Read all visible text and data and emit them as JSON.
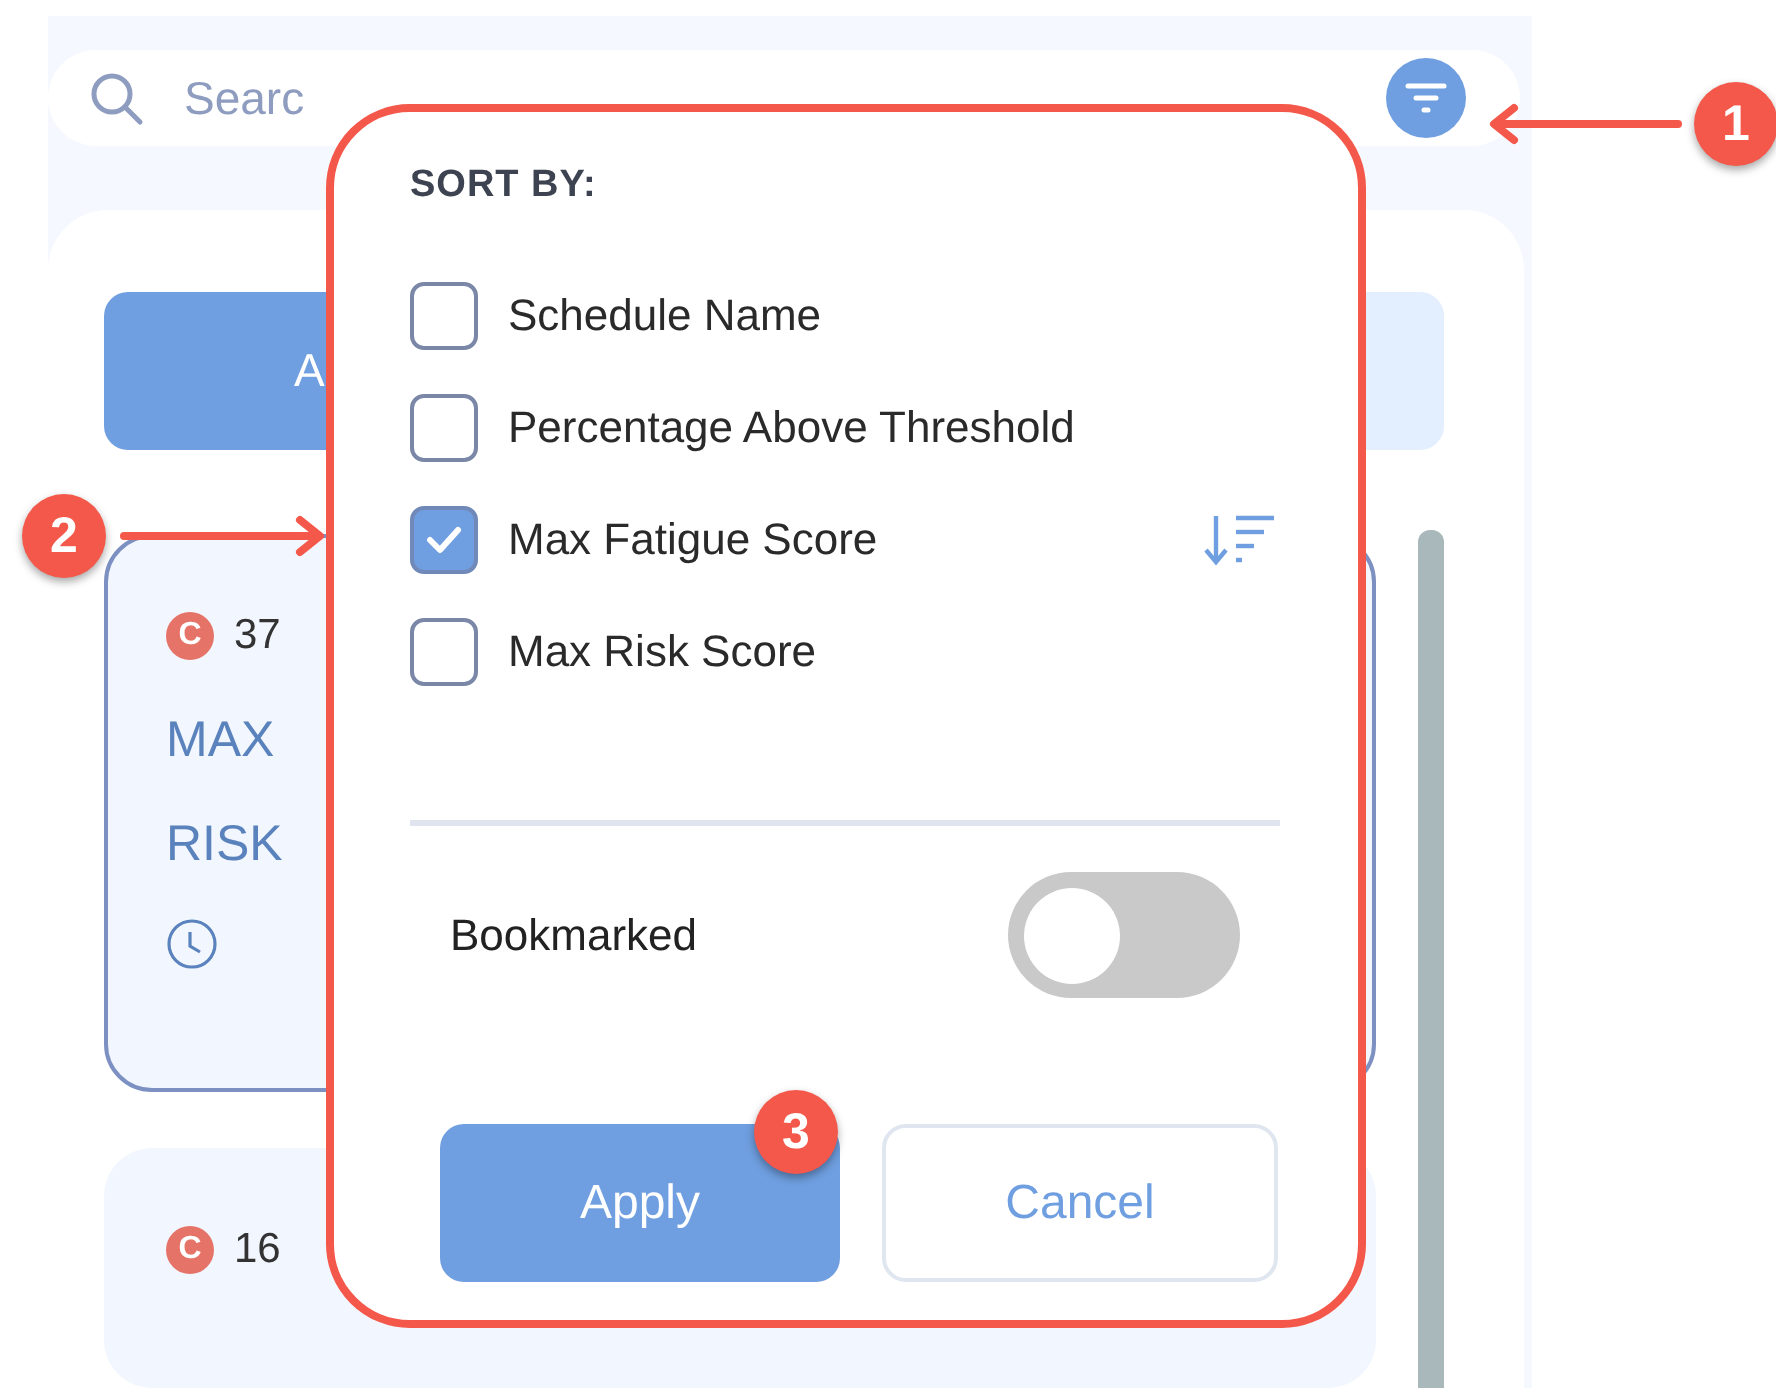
{
  "search": {
    "placeholder": "Searc"
  },
  "tabs": [
    {
      "label": "A",
      "selected": true
    },
    {
      "selected": false
    }
  ],
  "cards": [
    {
      "badge": "C",
      "id": "37",
      "lines": [
        "MAX",
        "RISK"
      ],
      "selected": true
    },
    {
      "badge": "C",
      "id": "16",
      "selected": false
    }
  ],
  "sort_popup": {
    "title": "SORT BY:",
    "options": [
      {
        "label": "Schedule Name",
        "checked": false
      },
      {
        "label": "Percentage Above Threshold",
        "checked": false
      },
      {
        "label": "Max Fatigue Score",
        "checked": true
      },
      {
        "label": "Max Risk Score",
        "checked": false
      }
    ],
    "bookmarked": {
      "label": "Bookmarked",
      "on": false
    },
    "buttons": [
      {
        "label": "Apply",
        "kind": "primary"
      },
      {
        "label": "Cancel",
        "kind": "secondary"
      }
    ]
  },
  "callouts": [
    {
      "number": "1"
    },
    {
      "number": "2"
    },
    {
      "number": "3"
    }
  ]
}
